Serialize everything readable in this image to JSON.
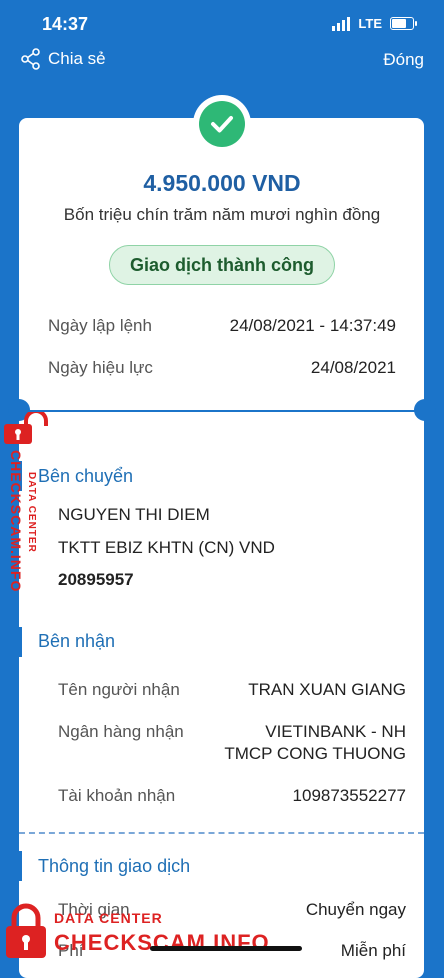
{
  "status_bar": {
    "time": "14:37",
    "network": "LTE"
  },
  "top_bar": {
    "share_label": "Chia sẻ",
    "close_label": "Đóng"
  },
  "transaction": {
    "amount": "4.950.000 VND",
    "amount_words": "Bốn triệu chín trăm năm mươi nghìn đồng",
    "status": "Giao dịch thành công",
    "order_date_label": "Ngày lập lệnh",
    "order_date": "24/08/2021 - 14:37:49",
    "effective_date_label": "Ngày hiệu lực",
    "effective_date": "24/08/2021"
  },
  "sender": {
    "title": "Bên chuyển",
    "name": "NGUYEN THI DIEM",
    "account_type": "TKTT EBIZ KHTN (CN) VND",
    "account_number": "20895957"
  },
  "recipient": {
    "title": "Bên nhận",
    "name_label": "Tên người nhận",
    "name": "TRAN XUAN GIANG",
    "bank_label": "Ngân hàng nhận",
    "bank_line1": "VIETINBANK - NH",
    "bank_line2": "TMCP CONG THUONG",
    "account_label": "Tài khoản nhận",
    "account": "109873552277"
  },
  "transaction_info": {
    "title": "Thông tin giao dịch",
    "time_label": "Thời gian",
    "time_value": "Chuyển ngay",
    "fee_label": "Phí",
    "fee_value": "Miễn phí"
  },
  "watermark": {
    "line1": "DATA CENTER",
    "line2": "CHECKSCAM.INFO"
  },
  "colors": {
    "primary": "#1b74c9",
    "success": "#2eb876",
    "watermark": "#dd2222"
  }
}
